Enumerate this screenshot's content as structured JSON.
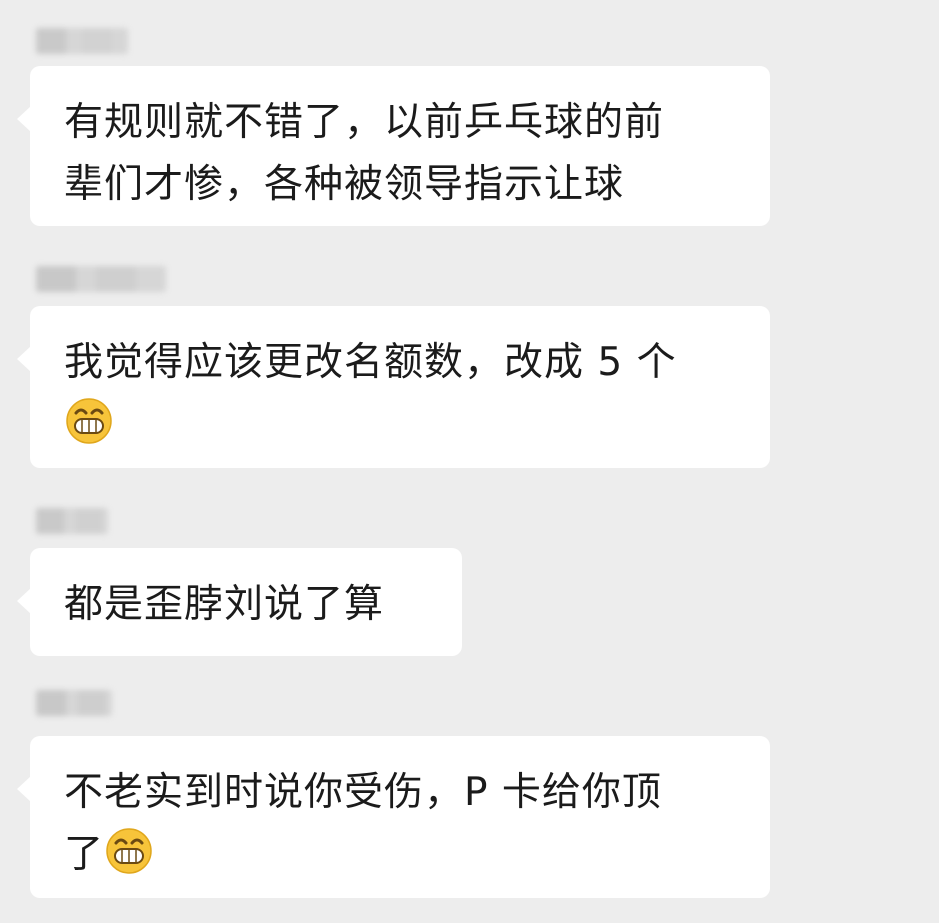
{
  "chat": {
    "messages": [
      {
        "sender": "",
        "lines": [
          "有规则就不错了，以前乒乓球的前",
          "辈们才惨，各种被领导指示让球"
        ],
        "emoji": null
      },
      {
        "sender": "",
        "lines": [
          "我觉得应该更改名额数，改成 5 个"
        ],
        "emoji": "grinning-face-emoji"
      },
      {
        "sender": "",
        "lines": [
          "都是歪脖刘说了算"
        ],
        "emoji": null
      },
      {
        "sender": "",
        "lines": [
          "不老实到时说你受伤，P 卡给你顶",
          "了"
        ],
        "emoji": "grinning-face-emoji"
      }
    ]
  },
  "colors": {
    "background": "#ededed",
    "bubble": "#ffffff",
    "text": "#1b1b1b",
    "emoji_face": "#f7c43a"
  }
}
